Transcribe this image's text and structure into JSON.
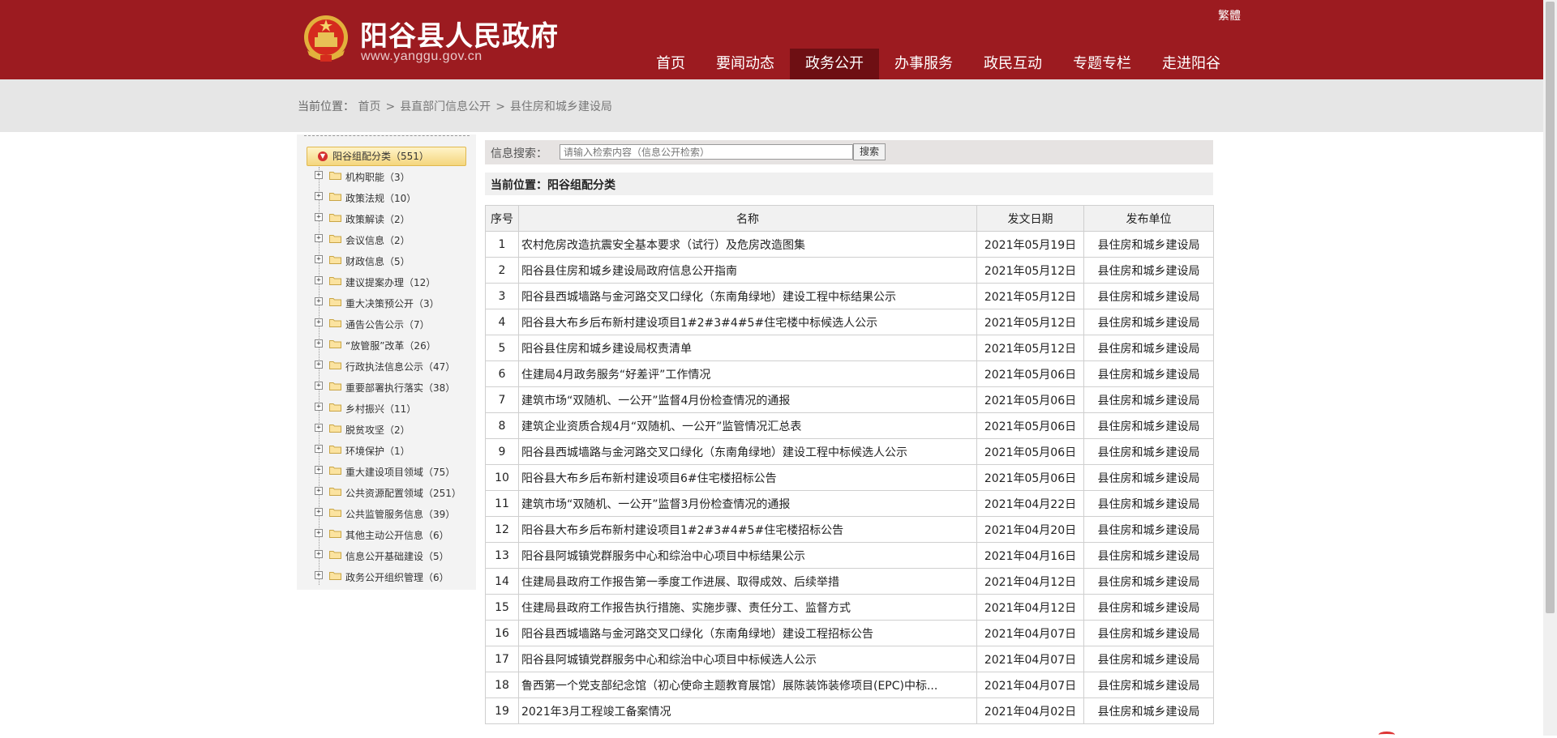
{
  "header": {
    "site_name": "阳谷县人民政府",
    "site_url": "www.yanggu.gov.cn",
    "lang_link": "繁體",
    "nav": [
      {
        "label": "首页",
        "active": false
      },
      {
        "label": "要闻动态",
        "active": false
      },
      {
        "label": "政务公开",
        "active": true
      },
      {
        "label": "办事服务",
        "active": false
      },
      {
        "label": "政民互动",
        "active": false
      },
      {
        "label": "专题专栏",
        "active": false
      },
      {
        "label": "走进阳谷",
        "active": false
      }
    ]
  },
  "breadcrumb": {
    "prefix": "当前位置：",
    "items": [
      "首页",
      "县直部门信息公开",
      "县住房和城乡建设局"
    ],
    "separator": ">"
  },
  "tree": {
    "root": "阳谷组配分类（551）",
    "items": [
      "机构职能（3）",
      "政策法规（10）",
      "政策解读（2）",
      "会议信息（2）",
      "财政信息（5）",
      "建议提案办理（12）",
      "重大决策预公开（3）",
      "通告公告公示（7）",
      "“放管服”改革（26）",
      "行政执法信息公示（47）",
      "重要部署执行落实（38）",
      "乡村振兴（11）",
      "脱贫攻坚（2）",
      "环境保护（1）",
      "重大建设项目领域（75）",
      "公共资源配置领域（251）",
      "公共监管服务信息（39）",
      "其他主动公开信息（6）",
      "信息公开基础建设（5）",
      "政务公开组织管理（6）"
    ]
  },
  "search": {
    "label": "信息搜索：",
    "placeholder": "请输入检索内容（信息公开检索）",
    "button": "搜索"
  },
  "location": {
    "text": "当前位置：阳谷组配分类"
  },
  "table": {
    "headers": [
      "序号",
      "名称",
      "发文日期",
      "发布单位"
    ],
    "rows": [
      [
        "1",
        "农村危房改造抗震安全基本要求（试行）及危房改造图集",
        "2021年05月19日",
        "县住房和城乡建设局"
      ],
      [
        "2",
        "阳谷县住房和城乡建设局政府信息公开指南",
        "2021年05月12日",
        "县住房和城乡建设局"
      ],
      [
        "3",
        "阳谷县西城墙路与金河路交叉口绿化（东南角绿地）建设工程中标结果公示",
        "2021年05月12日",
        "县住房和城乡建设局"
      ],
      [
        "4",
        "阳谷县大布乡后布新村建设项目1#2#3#4#5#住宅楼中标候选人公示",
        "2021年05月12日",
        "县住房和城乡建设局"
      ],
      [
        "5",
        "阳谷县住房和城乡建设局权责清单",
        "2021年05月12日",
        "县住房和城乡建设局"
      ],
      [
        "6",
        "住建局4月政务服务“好差评”工作情况",
        "2021年05月06日",
        "县住房和城乡建设局"
      ],
      [
        "7",
        "建筑市场“双随机、一公开”监督4月份检查情况的通报",
        "2021年05月06日",
        "县住房和城乡建设局"
      ],
      [
        "8",
        "建筑企业资质合规4月“双随机、一公开”监管情况汇总表",
        "2021年05月06日",
        "县住房和城乡建设局"
      ],
      [
        "9",
        "阳谷县西城墙路与金河路交叉口绿化（东南角绿地）建设工程中标候选人公示",
        "2021年05月06日",
        "县住房和城乡建设局"
      ],
      [
        "10",
        "阳谷县大布乡后布新村建设项目6#住宅楼招标公告",
        "2021年05月06日",
        "县住房和城乡建设局"
      ],
      [
        "11",
        "建筑市场“双随机、一公开”监督3月份检查情况的通报",
        "2021年04月22日",
        "县住房和城乡建设局"
      ],
      [
        "12",
        "阳谷县大布乡后布新村建设项目1#2#3#4#5#住宅楼招标公告",
        "2021年04月20日",
        "县住房和城乡建设局"
      ],
      [
        "13",
        "阳谷县阿城镇党群服务中心和综治中心项目中标结果公示",
        "2021年04月16日",
        "县住房和城乡建设局"
      ],
      [
        "14",
        "住建局县政府工作报告第一季度工作进展、取得成效、后续举措",
        "2021年04月12日",
        "县住房和城乡建设局"
      ],
      [
        "15",
        "住建局县政府工作报告执行措施、实施步骤、责任分工、监督方式",
        "2021年04月12日",
        "县住房和城乡建设局"
      ],
      [
        "16",
        "阳谷县西城墙路与金河路交叉口绿化（东南角绿地）建设工程招标公告",
        "2021年04月07日",
        "县住房和城乡建设局"
      ],
      [
        "17",
        "阳谷县阿城镇党群服务中心和综治中心项目中标候选人公示",
        "2021年04月07日",
        "县住房和城乡建设局"
      ],
      [
        "18",
        "鲁西第一个党支部纪念馆（初心使命主题教育展馆）展陈装饰装修项目(EPC)中标...",
        "2021年04月07日",
        "县住房和城乡建设局"
      ],
      [
        "19",
        "2021年3月工程竣工备案情况",
        "2021年04月02日",
        "县住房和城乡建设局"
      ]
    ]
  },
  "colors": {
    "header_bg": "#9c1b20",
    "nav_active_bg": "#6e0f13",
    "crumb_bg": "#e6e6e6"
  }
}
